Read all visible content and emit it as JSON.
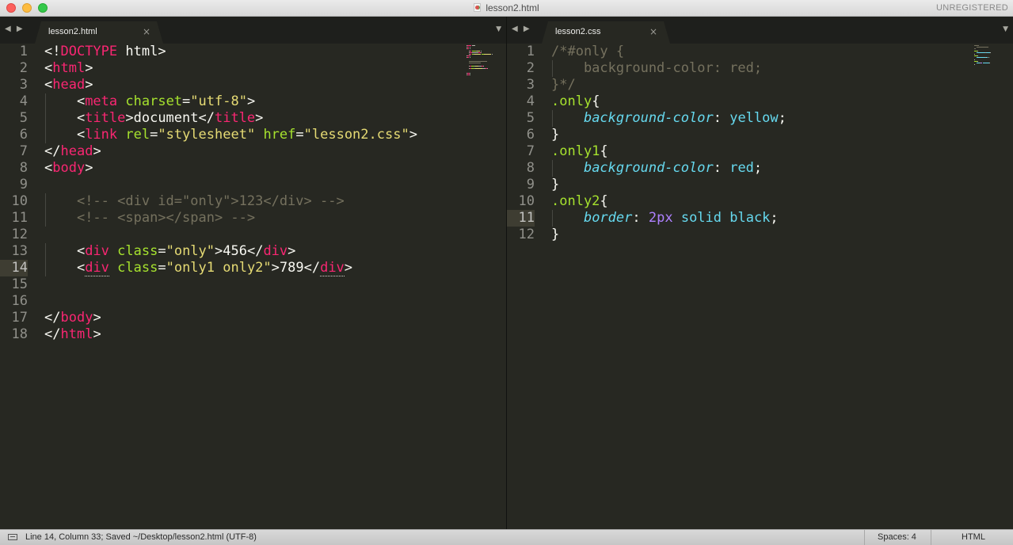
{
  "window": {
    "title": "lesson2.html",
    "badge": "UNREGISTERED"
  },
  "nav_arrows": "◀ ▶",
  "tab_close_glyph": "×",
  "dropdown_glyph": "▼",
  "left_pane": {
    "tab_label": "lesson2.html",
    "current_line": 14,
    "lines": [
      [
        [
          "tx",
          "<!"
        ],
        [
          "tg",
          "DOCTYPE"
        ],
        [
          "tx",
          " html>"
        ]
      ],
      [
        [
          "tx",
          "<"
        ],
        [
          "tg",
          "html"
        ],
        [
          "tx",
          ">"
        ]
      ],
      [
        [
          "tx",
          "<"
        ],
        [
          "tg",
          "head"
        ],
        [
          "tx",
          ">"
        ]
      ],
      [
        [
          "tx",
          "    <"
        ],
        [
          "tg",
          "meta"
        ],
        [
          "tx",
          " "
        ],
        [
          "at",
          "charset"
        ],
        [
          "tx",
          "="
        ],
        [
          "st",
          "\"utf-8\""
        ],
        [
          "tx",
          ">"
        ]
      ],
      [
        [
          "tx",
          "    <"
        ],
        [
          "tg",
          "title"
        ],
        [
          "tx",
          ">document</"
        ],
        [
          "tg",
          "title"
        ],
        [
          "tx",
          ">"
        ]
      ],
      [
        [
          "tx",
          "    <"
        ],
        [
          "tg",
          "link"
        ],
        [
          "tx",
          " "
        ],
        [
          "at",
          "rel"
        ],
        [
          "tx",
          "="
        ],
        [
          "st",
          "\"stylesheet\""
        ],
        [
          "tx",
          " "
        ],
        [
          "at",
          "href"
        ],
        [
          "tx",
          "="
        ],
        [
          "st",
          "\"lesson2.css\""
        ],
        [
          "tx",
          ">"
        ]
      ],
      [
        [
          "tx",
          "</"
        ],
        [
          "tg",
          "head"
        ],
        [
          "tx",
          ">"
        ]
      ],
      [
        [
          "tx",
          "<"
        ],
        [
          "tg",
          "body"
        ],
        [
          "tx",
          ">"
        ]
      ],
      [],
      [
        [
          "tx",
          "    "
        ],
        [
          "cm",
          "<!-- <div id=\"only\">123</div> -->"
        ]
      ],
      [
        [
          "tx",
          "    "
        ],
        [
          "cm",
          "<!-- <span></span> -->"
        ]
      ],
      [],
      [
        [
          "tx",
          "    <"
        ],
        [
          "tg",
          "div"
        ],
        [
          "tx",
          " "
        ],
        [
          "at",
          "class"
        ],
        [
          "tx",
          "="
        ],
        [
          "st",
          "\"only\""
        ],
        [
          "tx",
          ">456</"
        ],
        [
          "tg",
          "div"
        ],
        [
          "tx",
          ">"
        ]
      ],
      [
        [
          "tx",
          "    <"
        ],
        [
          "tgu",
          "div"
        ],
        [
          "tx",
          " "
        ],
        [
          "at",
          "class"
        ],
        [
          "tx",
          "="
        ],
        [
          "st",
          "\"only1 only2\""
        ],
        [
          "tx",
          ">789</"
        ],
        [
          "tgu",
          "div"
        ],
        [
          "tx",
          ">"
        ]
      ],
      [],
      [],
      [
        [
          "tx",
          "</"
        ],
        [
          "tg",
          "body"
        ],
        [
          "tx",
          ">"
        ]
      ],
      [
        [
          "tx",
          "</"
        ],
        [
          "tg",
          "html"
        ],
        [
          "tx",
          ">"
        ]
      ]
    ]
  },
  "right_pane": {
    "tab_label": "lesson2.css",
    "current_line": 11,
    "lines": [
      [
        [
          "cm",
          "/*#only {"
        ]
      ],
      [
        [
          "cm",
          "    background-color: red;"
        ]
      ],
      [
        [
          "cm",
          "}*/"
        ]
      ],
      [
        [
          "sel",
          ".only"
        ],
        [
          "tx",
          "{"
        ]
      ],
      [
        [
          "tx",
          "    "
        ],
        [
          "prop",
          "background-color"
        ],
        [
          "tx",
          ": "
        ],
        [
          "val",
          "yellow"
        ],
        [
          "tx",
          ";"
        ]
      ],
      [
        [
          "tx",
          "}"
        ]
      ],
      [
        [
          "sel",
          ".only1"
        ],
        [
          "tx",
          "{"
        ]
      ],
      [
        [
          "tx",
          "    "
        ],
        [
          "prop",
          "background-color"
        ],
        [
          "tx",
          ": "
        ],
        [
          "val",
          "red"
        ],
        [
          "tx",
          ";"
        ]
      ],
      [
        [
          "tx",
          "}"
        ]
      ],
      [
        [
          "sel",
          ".only2"
        ],
        [
          "tx",
          "{"
        ]
      ],
      [
        [
          "tx",
          "    "
        ],
        [
          "prop",
          "border"
        ],
        [
          "tx",
          ": "
        ],
        [
          "num",
          "2px"
        ],
        [
          "tx",
          " "
        ],
        [
          "val",
          "solid black"
        ],
        [
          "tx",
          ";"
        ]
      ],
      [
        [
          "tx",
          "}"
        ]
      ]
    ]
  },
  "status": {
    "position_text": "Line 14, Column 33; Saved ~/Desktop/lesson2.html (UTF-8)",
    "spaces": "Spaces: 4",
    "syntax": "HTML"
  },
  "colors": {
    "background": "#272822",
    "tag": "#f92672",
    "attribute": "#a6e22e",
    "string": "#e6db74",
    "comment": "#75715e",
    "property": "#66d9ef",
    "number": "#ae81ff"
  }
}
